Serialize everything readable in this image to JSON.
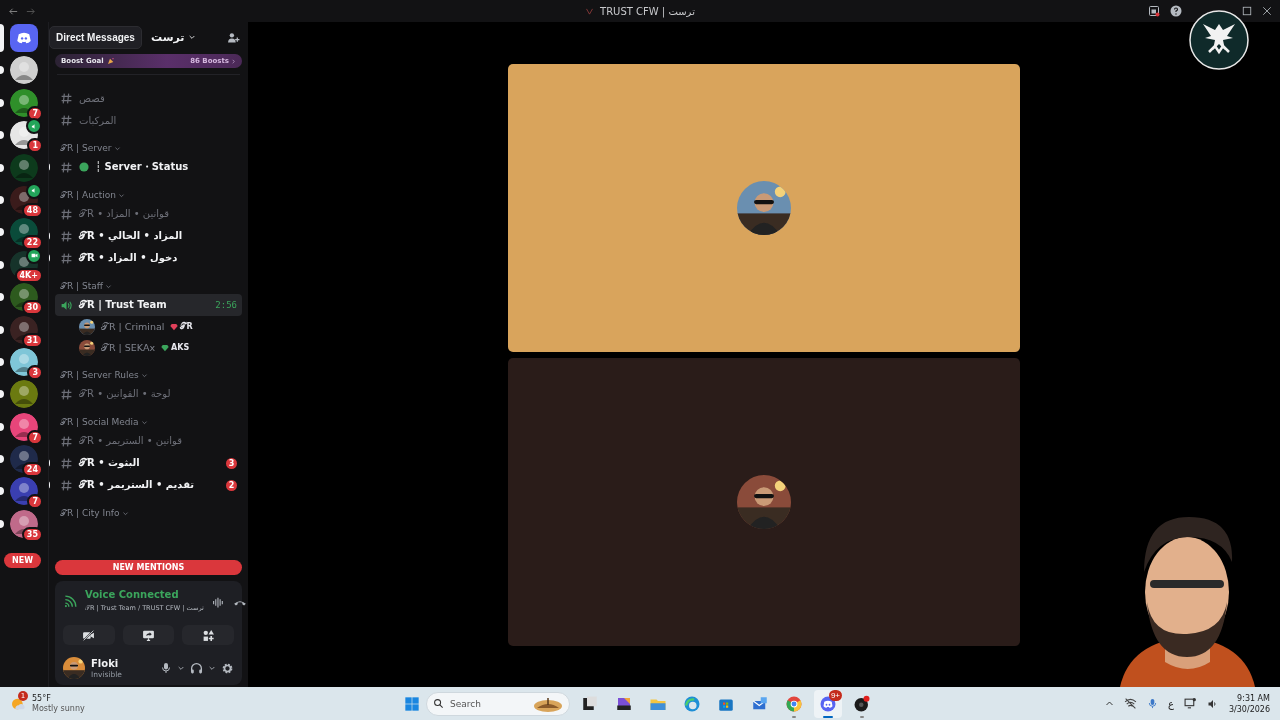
{
  "titlebar": {
    "title": "TRUST CFW | ترست"
  },
  "servers": [
    {
      "color": "#5865f2",
      "selected": true,
      "kind": "dm"
    },
    {
      "color": "#cfcfcf",
      "selected": false,
      "kind": "server"
    },
    {
      "color": "#2f8f2a",
      "selected": false,
      "kind": "server",
      "badge": "7"
    },
    {
      "color": "#e6e6e6",
      "selected": false,
      "kind": "server",
      "badge": "1",
      "voice": true
    },
    {
      "color": "#0d3a1c",
      "selected": false,
      "kind": "server"
    },
    {
      "color": "#3a1b1b",
      "selected": false,
      "kind": "server",
      "badge": "48",
      "voice": true
    },
    {
      "color": "#0a4b3a",
      "selected": false,
      "kind": "server",
      "badge": "22"
    },
    {
      "color": "#16332a",
      "selected": false,
      "kind": "server",
      "badge": "4K+",
      "video": true
    },
    {
      "color": "#2d5a1e",
      "selected": false,
      "kind": "server",
      "badge": "30"
    },
    {
      "color": "#3a2222",
      "selected": false,
      "kind": "server",
      "badge": "31"
    },
    {
      "color": "#7fc6d8",
      "selected": false,
      "kind": "server",
      "badge": "3"
    },
    {
      "color": "#6b7a10",
      "selected": false,
      "kind": "server"
    },
    {
      "color": "#e8457a",
      "selected": false,
      "kind": "server",
      "badge": "7"
    },
    {
      "color": "#1f2a4a",
      "selected": false,
      "kind": "server",
      "badge": "24"
    },
    {
      "color": "#3a3fb0",
      "selected": false,
      "kind": "server",
      "badge": "7"
    },
    {
      "color": "#c06a8a",
      "selected": false,
      "kind": "server",
      "badge": "35"
    }
  ],
  "tooltip": {
    "text": "Direct Messages"
  },
  "server_header": {
    "name": "ترست"
  },
  "boost": {
    "label": "Boost Goal",
    "count": "86 Boosts"
  },
  "channels": [
    {
      "kind": "text",
      "name": "قصص",
      "unread": false
    },
    {
      "kind": "text",
      "name": "المركبات",
      "unread": false
    },
    {
      "kind": "category",
      "name": "𝒯R | Server"
    },
    {
      "kind": "text",
      "name": "┆ Server・Status",
      "unread": true,
      "status_dot": true
    },
    {
      "kind": "category",
      "name": "𝒯R | Auction"
    },
    {
      "kind": "text",
      "name": "𝒯R • قوانين • المزاد",
      "unread": false
    },
    {
      "kind": "text",
      "name": "𝒯R • المزاد • الحالي",
      "unread": true
    },
    {
      "kind": "text",
      "name": "𝒯R • دخول • المزاد",
      "unread": true
    },
    {
      "kind": "category",
      "name": "𝒯R | Staff"
    },
    {
      "kind": "voice",
      "name": "𝒯R | Trust Team",
      "time": "2:56",
      "selected": true
    },
    {
      "kind": "member",
      "name": "𝒯R | Criminal",
      "tag": {
        "text": "𝒯R",
        "color": "#e0405a"
      }
    },
    {
      "kind": "member",
      "name": "𝒯R | SEKAx",
      "tag": {
        "text": "AKS",
        "color": "#3ba55c"
      }
    },
    {
      "kind": "category",
      "name": "𝒯R | Server Rules"
    },
    {
      "kind": "text",
      "name": "𝒯R • لوحة • القوانين",
      "unread": false
    },
    {
      "kind": "category",
      "name": "𝒯R | Social Media"
    },
    {
      "kind": "text",
      "name": "𝒯R • قوانين • الستريمر",
      "unread": false
    },
    {
      "kind": "text",
      "name": "𝒯R • البثوث",
      "unread": true,
      "badge": "3"
    },
    {
      "kind": "text",
      "name": "𝒯R • تقديم • الستريمر",
      "unread": true,
      "badge": "2"
    },
    {
      "kind": "category",
      "name": "𝒯R | City Info"
    }
  ],
  "mentions": {
    "new": "NEW",
    "label": "NEW MENTIONS"
  },
  "voice": {
    "status": "Voice Connected",
    "path": "𝒯R | Trust Team / TRUST CFW | ترست"
  },
  "user": {
    "name": "Floki",
    "status": "Invisible"
  },
  "tiles": [
    {
      "color": "#d9a45c"
    },
    {
      "color": "#2a1c19"
    }
  ],
  "taskbar": {
    "weather": {
      "temp": "55°F",
      "text": "Mostly sunny",
      "badge": "1"
    },
    "search": {
      "placeholder": "Search"
    },
    "apps": [
      {
        "kind": "taskview",
        "running": false,
        "active": false
      },
      {
        "kind": "office",
        "running": false,
        "active": false
      },
      {
        "kind": "folder",
        "running": false,
        "active": false
      },
      {
        "kind": "edge",
        "running": false,
        "active": false
      },
      {
        "kind": "store",
        "running": false,
        "active": false
      },
      {
        "kind": "mail",
        "running": false,
        "active": false
      },
      {
        "kind": "chrome",
        "running": true,
        "active": false
      },
      {
        "kind": "discord",
        "running": true,
        "active": true,
        "badge": "9+"
      },
      {
        "kind": "recorder",
        "running": true,
        "active": false
      }
    ],
    "language": "ع",
    "time": "9:31 AM",
    "date": "3/30/2026"
  }
}
